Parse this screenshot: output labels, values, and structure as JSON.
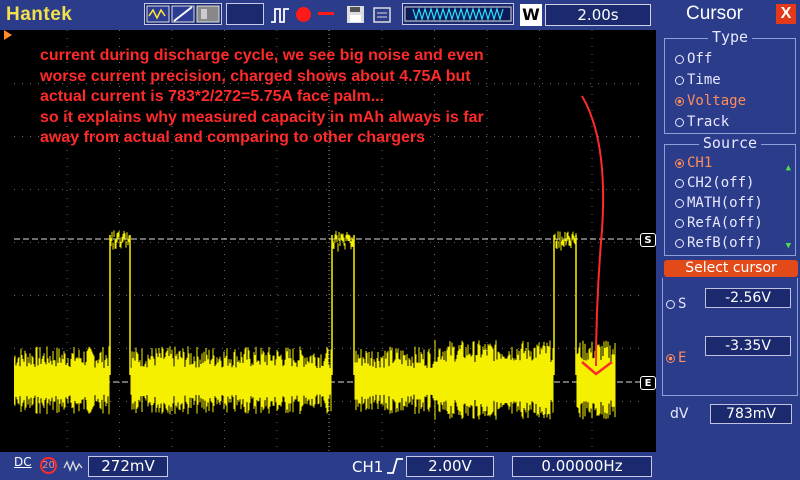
{
  "topbar": {
    "brand": "Hantek",
    "trigger_mode_box": "",
    "w_button": "W",
    "timebase": "2.00s"
  },
  "annotation": {
    "lines": [
      "current during discharge cycle, we see big noise and even",
      "worse current precision, charged shows about 4.75A but",
      "actual current is 783*2/272=5.75A face palm...",
      "so it explains why measured capacity in mAh always is far",
      "away from actual and comparing to other chargers"
    ],
    "color": "#ff2a2a"
  },
  "markers": {
    "cursor_s": "S",
    "cursor_e": "E"
  },
  "bottombar": {
    "coupling": "DC",
    "bw_limit": "20",
    "ch1_scale": "272mV",
    "trigger_channel": "CH1",
    "trigger_level": "2.00V",
    "frequency": "0.00000Hz"
  },
  "panel": {
    "title": "Cursor",
    "close_label": "X",
    "type_group": {
      "label": "Type",
      "options": [
        "Off",
        "Time",
        "Voltage",
        "Track"
      ],
      "selected": "Voltage"
    },
    "source_group": {
      "label": "Source",
      "options": [
        "CH1",
        "CH2(off)",
        "MATH(off)",
        "RefA(off)",
        "RefB(off)"
      ],
      "selected": "CH1"
    },
    "select_cursor_label": "Select cursor",
    "cursor_s_label": "S",
    "cursor_s_value": "-2.56V",
    "cursor_e_label": "E",
    "cursor_e_value": "-3.35V",
    "delta_label": "dV",
    "delta_value": "783mV"
  },
  "colors": {
    "trace": "#f5f000",
    "panel_bg": "#2a3c8a",
    "accent": "#e24a1a"
  }
}
